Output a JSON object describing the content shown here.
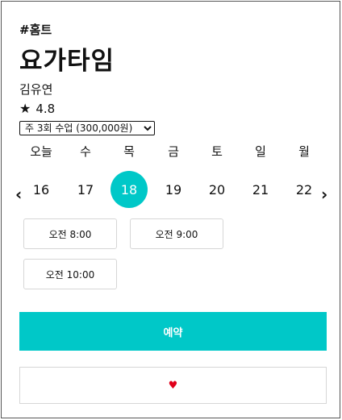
{
  "class": {
    "tag": "#홈트",
    "title": "요가타임",
    "instructor": "김유연",
    "rating_star": "★",
    "rating": "4.8"
  },
  "plan": {
    "selected": "주 3회 수업 (300,000원)"
  },
  "calendar": {
    "prev_icon": "‹",
    "next_icon": "›",
    "weekdays": [
      "오늘",
      "수",
      "목",
      "금",
      "토",
      "일",
      "월"
    ],
    "dates": [
      "16",
      "17",
      "18",
      "19",
      "20",
      "21",
      "22"
    ],
    "selected_date": "18"
  },
  "times": [
    "오전 8:00",
    "오전 9:00",
    "오전 10:00"
  ],
  "actions": {
    "reserve_label": "예약",
    "like_icon": "♥"
  },
  "colors": {
    "accent": "#00c8c8",
    "heart": "#e0001b"
  }
}
